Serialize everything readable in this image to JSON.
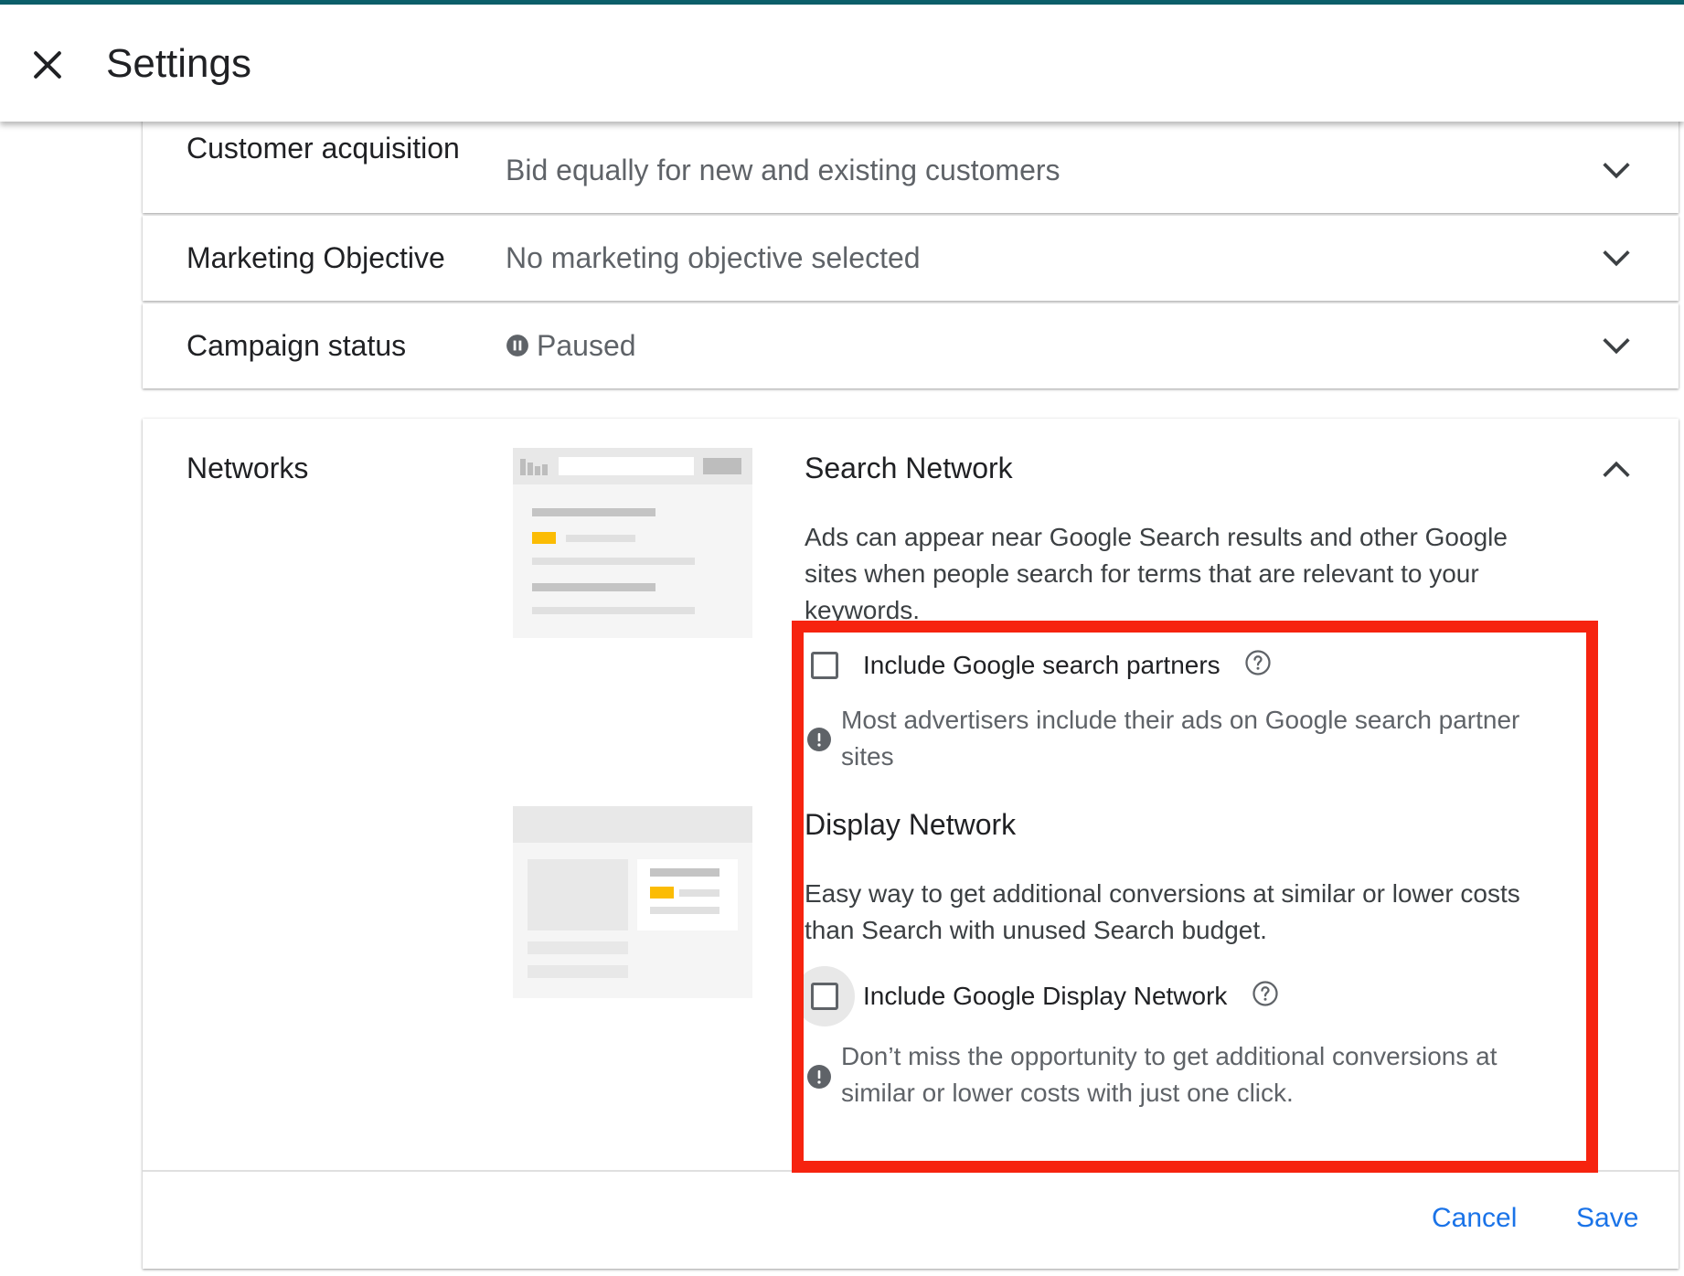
{
  "header": {
    "title": "Settings",
    "close_icon": "close-icon"
  },
  "rows": [
    {
      "label": "Customer acquisition",
      "value": "Bid equally for new and existing customers"
    },
    {
      "label": "Marketing Objective",
      "value": "No marketing objective selected"
    },
    {
      "label": "Campaign status",
      "value": "Paused",
      "status_icon": "pause-circle-icon"
    }
  ],
  "networks": {
    "label": "Networks",
    "search": {
      "title": "Search Network",
      "description": "Ads can appear near Google Search results and other Google sites when people search for terms that are relevant to your keywords.",
      "checkbox_label": "Include Google search partners",
      "checked": false,
      "note": "Most advertisers include their ads on Google search partner sites"
    },
    "display": {
      "title": "Display Network",
      "description": "Easy way to get additional conversions at similar or lower costs than Search with unused Search budget.",
      "checkbox_label": "Include Google Display Network",
      "checked": false,
      "note": "Don’t miss the opportunity to get additional conversions at similar or lower costs with just one click."
    }
  },
  "actions": {
    "cancel": "Cancel",
    "save": "Save"
  },
  "colors": {
    "accent": "#1a73e8",
    "highlight": "#f6230f",
    "top_bar": "#0b5f6a",
    "thumb_yellow": "#fbbc04"
  }
}
